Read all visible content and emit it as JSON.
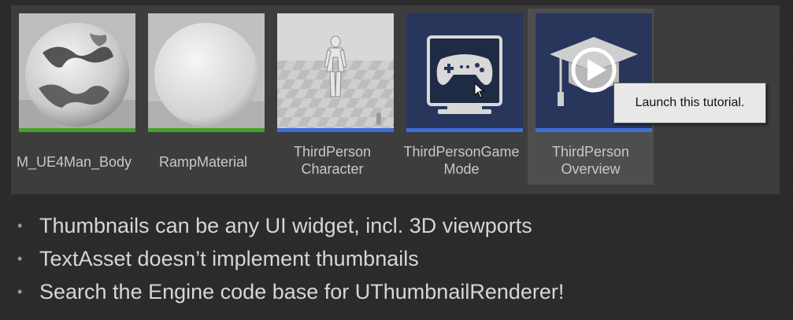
{
  "assets": [
    {
      "line1": "M_UE4Man_Body",
      "line2": "",
      "bar_color": "green"
    },
    {
      "line1": "RampMaterial",
      "line2": "",
      "bar_color": "green"
    },
    {
      "line1": "ThirdPerson",
      "line2": "Character",
      "bar_color": "blue"
    },
    {
      "line1": "ThirdPersonGame",
      "line2": "Mode",
      "bar_color": "blue"
    },
    {
      "line1": "ThirdPerson",
      "line2": "Overview",
      "bar_color": "blue"
    }
  ],
  "tooltip": {
    "text": "Launch this tutorial."
  },
  "bullets": [
    "Thumbnails can be any UI widget, incl. 3D viewports",
    "TextAsset doesn’t implement thumbnails",
    "Search the Engine code base for UThumbnailRenderer!"
  ],
  "colors": {
    "green_bar": "#46a02c",
    "blue_bar": "#3e6fd6",
    "panel": "#3d3d3d",
    "background": "#2a2a2a"
  },
  "icons": [
    "marble-sphere-icon",
    "gray-sphere-icon",
    "mannequin-icon",
    "gamepad-monitor-icon",
    "graduation-cap-play-icon",
    "mouse-cursor-icon"
  ]
}
